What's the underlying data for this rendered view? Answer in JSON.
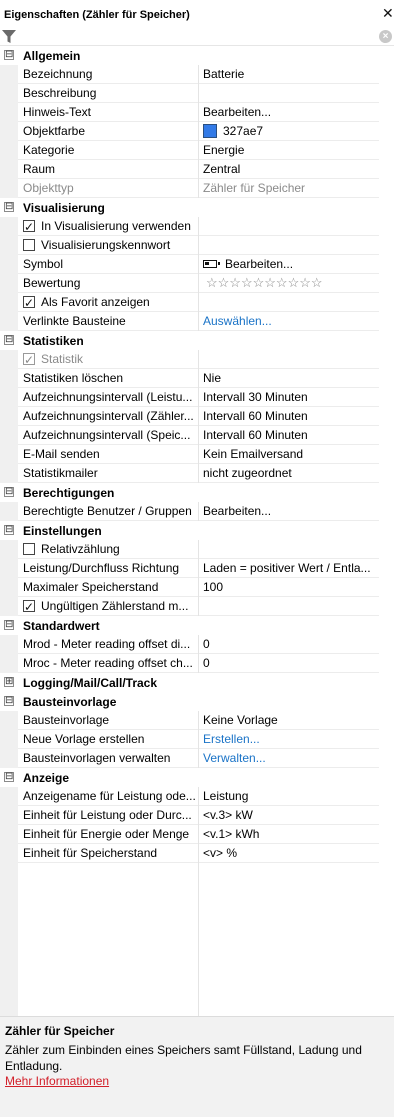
{
  "panel": {
    "title": "Eigenschaften (Zähler für Speicher)"
  },
  "filter": {
    "value": "",
    "placeholder": ""
  },
  "colors": {
    "objektfarbe": "#327ae7",
    "link": "#1a73c7",
    "more_info": "#d2202a"
  },
  "categories": {
    "allgemein": {
      "label": "Allgemein",
      "rows": [
        {
          "name": "Bezeichnung",
          "value": "Batterie"
        },
        {
          "name": "Beschreibung",
          "value": ""
        },
        {
          "name": "Hinweis-Text",
          "value": "Bearbeiten..."
        },
        {
          "name": "Objektfarbe",
          "value": "327ae7"
        },
        {
          "name": "Kategorie",
          "value": "Energie"
        },
        {
          "name": "Raum",
          "value": "Zentral"
        },
        {
          "name": "Objekttyp",
          "value": "Zähler für Speicher"
        }
      ]
    },
    "visualisierung": {
      "label": "Visualisierung",
      "rows": [
        {
          "name": "In Visualisierung verwenden",
          "checked": true
        },
        {
          "name": "Visualisierungskennwort",
          "checked": false
        },
        {
          "name": "Symbol",
          "value": "Bearbeiten...",
          "icon": "battery-icon"
        },
        {
          "name": "Bewertung",
          "value": "☆☆☆☆☆☆☆☆☆☆",
          "rating": 0,
          "rating_max": 10
        },
        {
          "name": "Als Favorit anzeigen",
          "checked": true
        },
        {
          "name": "Verlinkte Bausteine",
          "value": "Auswählen..."
        }
      ]
    },
    "statistiken": {
      "label": "Statistiken",
      "rows": [
        {
          "name": "Statistik",
          "checked": true
        },
        {
          "name": "Statistiken löschen",
          "value": "Nie"
        },
        {
          "name": "Aufzeichnungsintervall (Leistu...",
          "value": "Intervall 30 Minuten"
        },
        {
          "name": "Aufzeichnungsintervall (Zähler...",
          "value": "Intervall 60 Minuten"
        },
        {
          "name": "Aufzeichnungsintervall (Speic...",
          "value": "Intervall 60 Minuten"
        },
        {
          "name": "E-Mail senden",
          "value": "Kein Emailversand"
        },
        {
          "name": "Statistikmailer",
          "value": "nicht zugeordnet"
        }
      ]
    },
    "berechtigungen": {
      "label": "Berechtigungen",
      "rows": [
        {
          "name": "Berechtigte Benutzer / Gruppen",
          "value": "Bearbeiten..."
        }
      ]
    },
    "einstellungen": {
      "label": "Einstellungen",
      "rows": [
        {
          "name": "Relativzählung",
          "checked": false
        },
        {
          "name": "Leistung/Durchfluss Richtung",
          "value": "Laden = positiver Wert / Entla..."
        },
        {
          "name": "Maximaler Speicherstand",
          "value": "100"
        },
        {
          "name": "Ungültigen Zählerstand m...",
          "checked": true
        }
      ]
    },
    "standardwert": {
      "label": "Standardwert",
      "rows": [
        {
          "name": "Mrod - Meter reading offset di...",
          "value": "0"
        },
        {
          "name": "Mroc - Meter reading offset ch...",
          "value": "0"
        }
      ]
    },
    "logging": {
      "label": "Logging/Mail/Call/Track"
    },
    "bausteinvorlage": {
      "label": "Bausteinvorlage",
      "rows": [
        {
          "name": "Bausteinvorlage",
          "value": "Keine Vorlage"
        },
        {
          "name": "Neue Vorlage erstellen",
          "value": "Erstellen..."
        },
        {
          "name": "Bausteinvorlagen verwalten",
          "value": "Verwalten..."
        }
      ]
    },
    "anzeige": {
      "label": "Anzeige",
      "rows": [
        {
          "name": "Anzeigename für Leistung ode...",
          "value": "Leistung"
        },
        {
          "name": "Einheit für Leistung oder Durc...",
          "value": "<v.3> kW"
        },
        {
          "name": "Einheit für Energie oder Menge",
          "value": "<v.1> kWh"
        },
        {
          "name": "Einheit für Speicherstand",
          "value": "<v> %"
        }
      ]
    }
  },
  "expanders": {
    "expanded": "⊟",
    "collapsed": "⊞"
  },
  "description": {
    "title": "Zähler für Speicher",
    "text": "Zähler zum Einbinden eines Speichers samt Füllstand, Ladung und Entladung.",
    "link": "Mehr Informationen"
  }
}
